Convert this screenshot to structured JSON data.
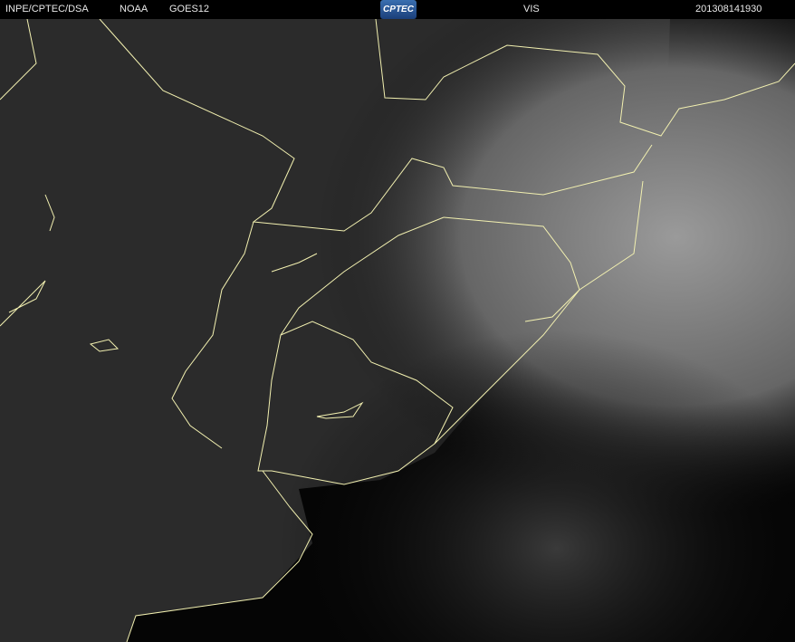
{
  "header": {
    "source": "INPE/CPTEC/DSA",
    "agency": "NOAA",
    "satellite": "GOES12",
    "logo_text": "CPTEC",
    "channel": "VIS",
    "timestamp": "201308141930"
  },
  "colors": {
    "border_lines": "#f2f0b0",
    "land": "#2a2a2a",
    "ocean": "#050505",
    "clouds": "#8a8a8a"
  }
}
